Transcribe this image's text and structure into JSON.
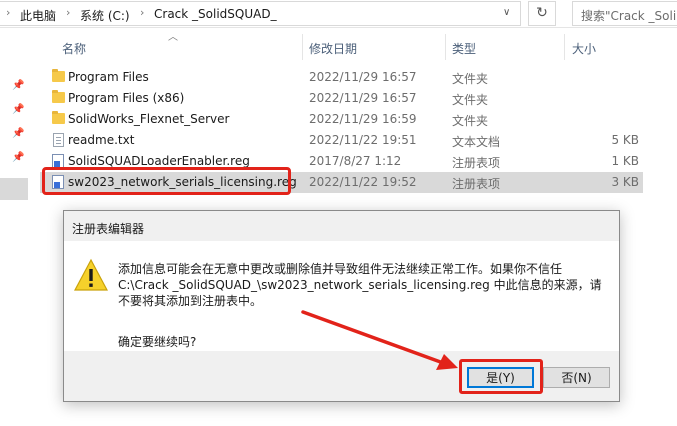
{
  "address_bar": {
    "breadcrumbs": [
      "此电脑",
      "系统 (C:)",
      "Crack _SolidSQUAD_"
    ],
    "search_placeholder": "搜索\"Crack _Soli"
  },
  "columns": {
    "name": "名称",
    "date": "修改日期",
    "type": "类型",
    "size": "大小"
  },
  "files": [
    {
      "name": "Program Files",
      "date": "2022/11/29 16:57",
      "type": "文件夹",
      "size": "",
      "icon": "folder-icon"
    },
    {
      "name": "Program Files (x86)",
      "date": "2022/11/29 16:57",
      "type": "文件夹",
      "size": "",
      "icon": "folder-icon"
    },
    {
      "name": "SolidWorks_Flexnet_Server",
      "date": "2022/11/29 16:59",
      "type": "文件夹",
      "size": "",
      "icon": "folder-icon"
    },
    {
      "name": "readme.txt",
      "date": "2022/11/22 19:51",
      "type": "文本文档",
      "size": "5 KB",
      "icon": "text-file-icon"
    },
    {
      "name": "SolidSQUADLoaderEnabler.reg",
      "date": "2017/8/27 1:12",
      "type": "注册表项",
      "size": "1 KB",
      "icon": "registry-file-icon"
    },
    {
      "name": "sw2023_network_serials_licensing.reg",
      "date": "2022/11/22 19:52",
      "type": "注册表项",
      "size": "3 KB",
      "icon": "registry-file-icon",
      "selected": true
    }
  ],
  "dialog": {
    "title": "注册表编辑器",
    "message": "添加信息可能会在无意中更改或删除值并导致组件无法继续正常工作。如果你不信任 C:\\Crack _SolidSQUAD_\\sw2023_network_serials_licensing.reg 中此信息的来源，请不要将其添加到注册表中。",
    "confirm": "确定要继续吗?",
    "yes_label": "是(Y)",
    "no_label": "否(N)",
    "icon": "warning-icon"
  },
  "annotation_color": "#e2231a"
}
